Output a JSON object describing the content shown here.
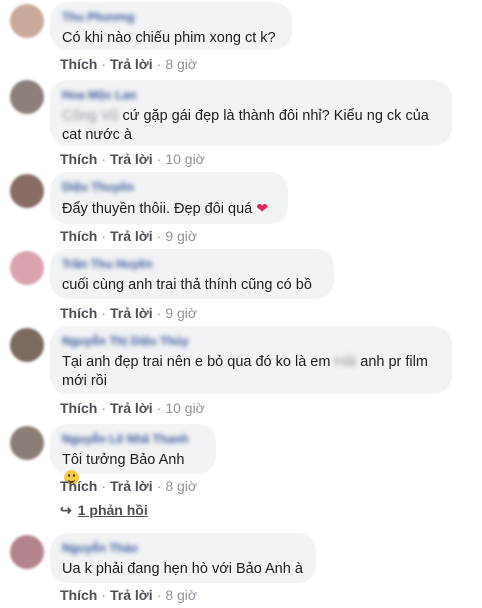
{
  "labels": {
    "like": "Thích",
    "reply": "Trả lời",
    "dot": "·"
  },
  "comments": [
    {
      "name": "Thu Phương",
      "text": "Có khi nào chiếu phim xong ct k?",
      "time": "8 giờ"
    },
    {
      "name": "Hoa Mộc Lan",
      "tag": "Công Vũ",
      "text": "cứ gặp gái đẹp là thành đôi nhỉ? Kiểu ng ck của cat nước à",
      "time": "10 giờ"
    },
    {
      "name": "Diệu Thuyên",
      "text": "Đẩy thuyền thôii. Đẹp đôi quá",
      "emoji": "heart",
      "time": "9 giờ"
    },
    {
      "name": "Trần Thu Huyền",
      "text": "cuối cùng anh trai thả thính cũng có bồ",
      "time": "9 giờ"
    },
    {
      "name": "Nguyễn Thị Diệu Thúy",
      "text_before": "Tại anh đẹp trai nên e bỏ qua đó ko là em",
      "tag": "Hải",
      "text_after": "anh pr film mới rồi",
      "time": "10 giờ"
    },
    {
      "name": "Nguyễn Lê Nhã Thanh",
      "text": "Tôi tưởng Bảo Anh",
      "emoji": "smile",
      "time": "8 giờ"
    },
    {
      "name": "Nguyễn Thảo",
      "text": "Ua k phải đang hẹn hò với Bảo Anh à",
      "time": "8 giờ"
    }
  ],
  "replies_link": {
    "arrow": "↪",
    "label": "1 phản hồi"
  },
  "avatar_colors": [
    "#c9a99a",
    "#8d7f7b",
    "#8a6c66",
    "#d9a3b0",
    "#7b6a60",
    "#8b7e76",
    "#b3848e"
  ]
}
